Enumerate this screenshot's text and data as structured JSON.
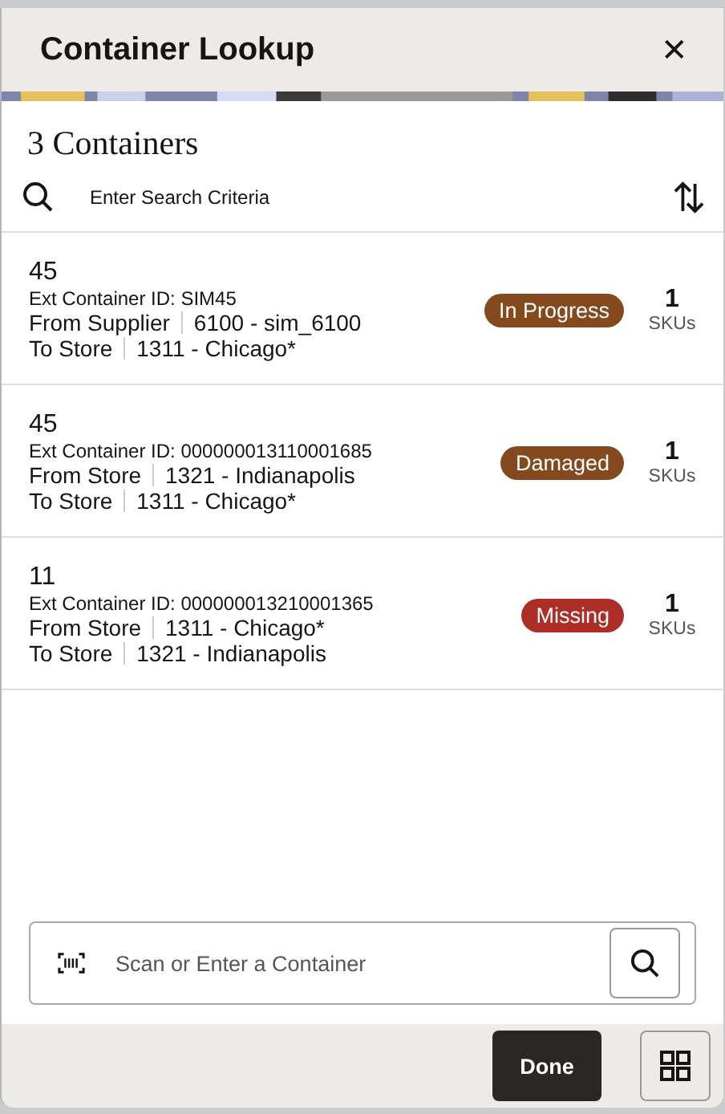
{
  "dialog": {
    "title": "Container Lookup",
    "close_icon": "✕"
  },
  "list_title": "3 Containers",
  "search": {
    "placeholder": "Enter Search Criteria"
  },
  "containers": [
    {
      "number": "45",
      "ext_id": "Ext Container ID: SIM45",
      "from_label": "From Supplier",
      "from_value": "6100 - sim_6100",
      "to_label": "To Store",
      "to_value": "1311 - Chicago*",
      "status": "In Progress",
      "color": "#84491c",
      "sku_count": "1",
      "sku_label": "SKUs"
    },
    {
      "number": "45",
      "ext_id": "Ext Container ID: 000000013110001685",
      "from_label": "From Store",
      "from_value": "1321 - Indianapolis",
      "to_label": "To Store",
      "to_value": "1311 - Chicago*",
      "status": "Damaged",
      "color": "#84491c",
      "sku_count": "1",
      "sku_label": "SKUs"
    },
    {
      "number": "11",
      "ext_id": "Ext Container ID: 000000013210001365",
      "from_label": "From Store",
      "from_value": "1311 - Chicago*",
      "to_label": "To Store",
      "to_value": "1321 - Indianapolis",
      "status": "Missing",
      "color": "#ad2e26",
      "sku_count": "1",
      "sku_label": "SKUs"
    }
  ],
  "scan": {
    "placeholder": "Scan or Enter a Container"
  },
  "footer": {
    "done": "Done"
  }
}
